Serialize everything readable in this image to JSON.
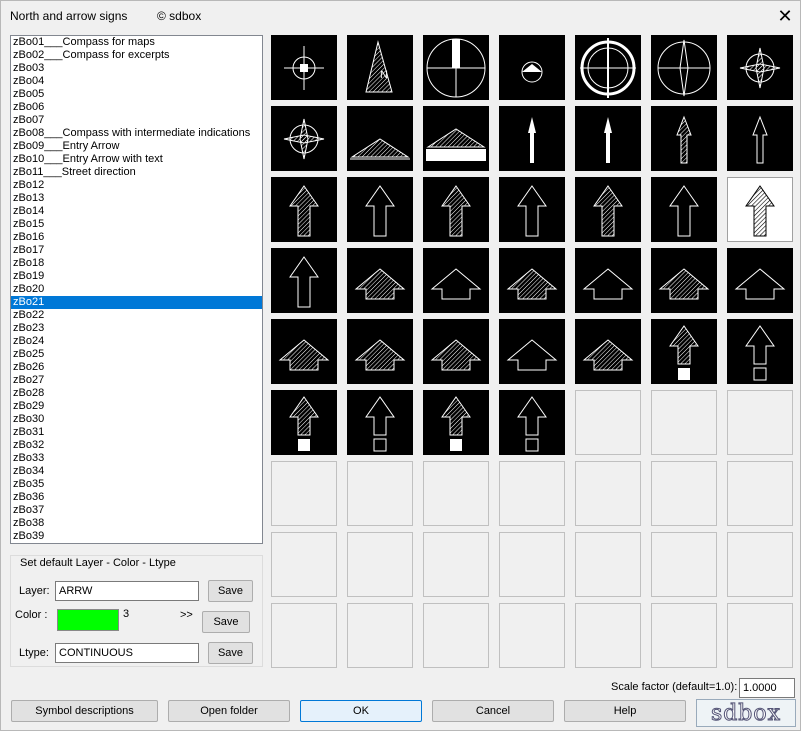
{
  "window": {
    "title": "North and arrow signs",
    "copyright": "© sdbox",
    "close_glyph": "✕"
  },
  "list": {
    "selected_index": 20,
    "items": [
      "zBo01___Compass for maps",
      "zBo02___Compass for excerpts",
      "zBo03",
      "zBo04",
      "zBo05",
      "zBo06",
      "zBo07",
      "zBo08___Compass with intermediate indications",
      "zBo09___Entry Arrow",
      "zBo10___Entry Arrow with text",
      "zBo11___Street direction",
      "zBo12",
      "zBo13",
      "zBo14",
      "zBo15",
      "zBo16",
      "zBo17",
      "zBo18",
      "zBo19",
      "zBo20",
      "zBo21",
      "zBo22",
      "zBo23",
      "zBo24",
      "zBo25",
      "zBo26",
      "zBo27",
      "zBo28",
      "zBo29",
      "zBo30",
      "zBo31",
      "zBo32",
      "zBo33",
      "zBo34",
      "zBo35",
      "zBo36",
      "zBo37",
      "zBo38",
      "zBo39"
    ]
  },
  "defaults": {
    "group_label": "Set default Layer - Color - Ltype",
    "layer_label": "Layer:",
    "layer_value": "ARRW",
    "color_label": "Color :",
    "color_number": "3",
    "color_hex": "#00ff00",
    "color_arrow": ">>",
    "ltype_label": "Ltype:",
    "ltype_value": "CONTINUOUS",
    "save_label": "Save"
  },
  "thumbnails": [
    "compass-1",
    "compass-2",
    "compass-3",
    "compass-4",
    "compass-5",
    "compass-6",
    "compass-7",
    "compass-8",
    "entry-arrow",
    "entrance-arrow",
    "street-arrow",
    "street-arrow-thin",
    "street-arrow-hatched",
    "street-arrow-outline",
    "arrow-hatched",
    "arrow-outline",
    "arrow-hatched-small",
    "arrow-outline-small",
    "arrow-hatched-small",
    "arrow-outline-small",
    "arrow-hatched-selected",
    "arrow-outline",
    "arrow-hatched-wide",
    "arrow-outline-wide",
    "arrow-flat-hatched",
    "arrow-flat-outline",
    "arrow-flat-hatched",
    "arrow-flat-outline",
    "arrow-half-hatched",
    "arrow-half-hatched",
    "arrow-flat-hatched-low",
    "arrow-flat-outline-low",
    "arrow-half-hatched-low",
    "arrow-stem-hatched",
    "arrow-stem-outline",
    "arrow-block-hatched",
    "arrow-block-outline",
    "arrow-block-hatched-wide",
    "arrow-block-outline-wide",
    "",
    "",
    "",
    "",
    "",
    "",
    "",
    "",
    "",
    "",
    "",
    "",
    "",
    "",
    "",
    "",
    "",
    "",
    "",
    "",
    "",
    "",
    "",
    ""
  ],
  "scale": {
    "label": "Scale factor (default=1.0):",
    "value": "1.0000"
  },
  "buttons": {
    "symbol_descriptions": "Symbol descriptions",
    "open_folder": "Open folder",
    "ok": "OK",
    "cancel": "Cancel",
    "help": "Help"
  },
  "logo": {
    "text": "sdbox"
  }
}
